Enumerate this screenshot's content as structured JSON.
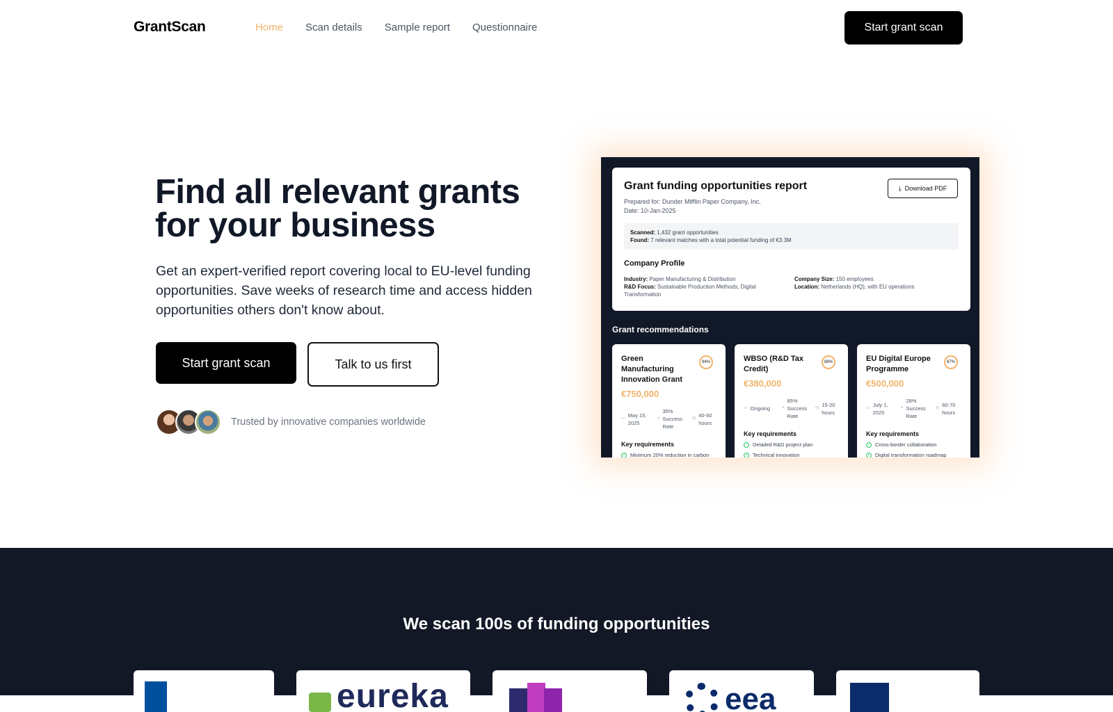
{
  "nav": {
    "logo": "GrantScan",
    "links": [
      {
        "label": "Home",
        "active": true
      },
      {
        "label": "Scan details",
        "active": false
      },
      {
        "label": "Sample report",
        "active": false
      },
      {
        "label": "Questionnaire",
        "active": false
      }
    ],
    "cta": "Start grant scan"
  },
  "hero": {
    "title_line1": "Find all relevant grants",
    "title_line2": "for your business",
    "subtitle": "Get an expert-verified report covering local to EU-level funding opportunities. Save weeks of research time and access hidden opportunities others don't know about.",
    "primary_button": "Start grant scan",
    "secondary_button": "Talk to us first",
    "trust_text": "Trusted by innovative companies worldwide"
  },
  "report": {
    "title": "Grant funding opportunities report",
    "prepared_for": "Prepared for: Dunder Mifflin Paper Company, Inc.",
    "date": "Date: 10-Jan-2025",
    "download_label": "Download PDF",
    "scanned_label": "Scanned:",
    "scanned_value": "1,432 grant opportunities",
    "found_label": "Found:",
    "found_value": "7 relevant matches with a total potential funding of €3.3M",
    "profile_title": "Company Profile",
    "industry_label": "Industry:",
    "industry_value": "Paper Manufacturing & Distribution",
    "rd_label": "R&D Focus:",
    "rd_value": "Sustainable Production Methods, Digital Transformation",
    "size_label": "Company Size:",
    "size_value": "150 employees",
    "location_label": "Location:",
    "location_value": "Netherlands (HQ), with EU operations",
    "recommendations_title": "Grant recommendations",
    "key_requirements_label": "Key requirements",
    "cards": [
      {
        "name": "Green Manufacturing Innovation Grant",
        "match": "94%",
        "amount": "€750,000",
        "deadline": "May 15, 2025",
        "success": "35% Success Rate",
        "effort": "40-50 hours",
        "requirements": [
          "Minimum 20% reduction in carbon"
        ]
      },
      {
        "name": "WBSO (R&D Tax Credit)",
        "match": "89%",
        "amount": "€380,000",
        "deadline": "Ongoing",
        "success": "85% Success Rate",
        "effort": "15-20 hours",
        "requirements": [
          "Detailed R&D project plan",
          "Technical innovation"
        ]
      },
      {
        "name": "EU Digital Europe Programme",
        "match": "87%",
        "amount": "€500,000",
        "deadline": "July 1, 2025",
        "success": "28% Success Rate",
        "effort": "60-70 hours",
        "requirements": [
          "Cross-border collaboration",
          "Digital transformation roadmap"
        ]
      }
    ]
  },
  "funders": {
    "title": "We scan 100s of funding opportunities"
  },
  "colors": {
    "accent": "#f0b46a",
    "dark_bg": "#121826",
    "check": "#22c55e"
  }
}
